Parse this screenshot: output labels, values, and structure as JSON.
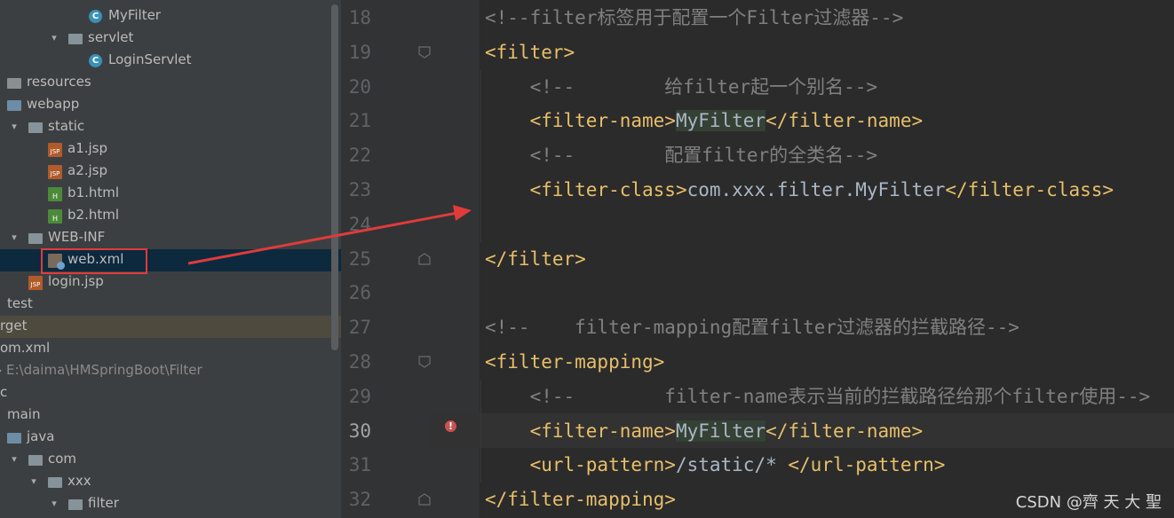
{
  "project_tree": {
    "items": [
      {
        "label": "MyFilter",
        "icon": "class-icon"
      },
      {
        "label": "servlet",
        "icon": "folder-icon",
        "arrow": "expanded"
      },
      {
        "label": "LoginServlet",
        "icon": "class-icon"
      },
      {
        "label": "resources",
        "icon": "resources-folder-icon"
      },
      {
        "label": "webapp",
        "icon": "web-folder-icon"
      },
      {
        "label": "static",
        "icon": "folder-icon",
        "arrow": "expanded"
      },
      {
        "label": "a1.jsp",
        "icon": "jsp-file-icon"
      },
      {
        "label": "a2.jsp",
        "icon": "jsp-file-icon"
      },
      {
        "label": "b1.html",
        "icon": "html-file-icon"
      },
      {
        "label": "b2.html",
        "icon": "html-file-icon"
      },
      {
        "label": "WEB-INF",
        "icon": "folder-icon",
        "arrow": "expanded"
      },
      {
        "label": "web.xml",
        "icon": "xml-file-icon",
        "selected": true
      },
      {
        "label": "login.jsp",
        "icon": "jsp-file-icon"
      },
      {
        "label": "test",
        "icon": "none"
      },
      {
        "label": "rget",
        "icon": "none",
        "highlight": true
      },
      {
        "label": "om.xml",
        "icon": "none"
      },
      {
        "label": "E:\\daima\\HMSpringBoot\\Filter",
        "icon": "none",
        "muted": true
      },
      {
        "label": "c",
        "icon": "none"
      },
      {
        "label": "main",
        "icon": "none"
      },
      {
        "label": "java",
        "icon": "source-folder-icon"
      },
      {
        "label": "com",
        "icon": "package-folder-icon",
        "arrow": "expanded"
      },
      {
        "label": "xxx",
        "icon": "package-folder-icon",
        "arrow": "expanded"
      },
      {
        "label": "filter",
        "icon": "package-folder-icon",
        "arrow": "expanded"
      }
    ]
  },
  "editor": {
    "current_line": 30,
    "lines": [
      {
        "num": "18",
        "segments": [
          {
            "t": "<!--filter标签用于配置一个Filter过滤器-->",
            "c": "cmt"
          }
        ]
      },
      {
        "num": "19",
        "segments": [
          {
            "t": "<filter>",
            "c": "tag"
          }
        ]
      },
      {
        "num": "20",
        "segments": [
          {
            "t": "    <!--        给filter起一个别名-->",
            "c": "cmt"
          }
        ]
      },
      {
        "num": "21",
        "segments": [
          {
            "t": "    ",
            "c": "txt"
          },
          {
            "t": "<filter-name>",
            "c": "tag"
          },
          {
            "t": "MyFilter",
            "c": "ident"
          },
          {
            "t": "</filter-name>",
            "c": "tag"
          }
        ]
      },
      {
        "num": "22",
        "segments": [
          {
            "t": "    <!--        配置filter的全类名-->",
            "c": "cmt"
          }
        ]
      },
      {
        "num": "23",
        "segments": [
          {
            "t": "    ",
            "c": "txt"
          },
          {
            "t": "<filter-class>",
            "c": "tag"
          },
          {
            "t": "com.xxx.filter.MyFilter",
            "c": "txt"
          },
          {
            "t": "</filter-class>",
            "c": "tag"
          }
        ]
      },
      {
        "num": "24",
        "segments": []
      },
      {
        "num": "25",
        "segments": [
          {
            "t": "</filter>",
            "c": "tag"
          }
        ]
      },
      {
        "num": "26",
        "segments": []
      },
      {
        "num": "27",
        "segments": [
          {
            "t": "<!--    filter-mapping配置filter过滤器的拦截路径-->",
            "c": "cmt"
          }
        ]
      },
      {
        "num": "28",
        "segments": [
          {
            "t": "<filter-mapping>",
            "c": "tag"
          }
        ]
      },
      {
        "num": "29",
        "segments": [
          {
            "t": "    <!--        filter-name表示当前的拦截路径给那个filter使用-->",
            "c": "cmt"
          }
        ]
      },
      {
        "num": "30",
        "segments": [
          {
            "t": "    ",
            "c": "txt"
          },
          {
            "t": "<filter-name>",
            "c": "tag"
          },
          {
            "t": "MyFilter",
            "c": "ident"
          },
          {
            "t": "</filter-name>",
            "c": "tag"
          }
        ]
      },
      {
        "num": "31",
        "segments": [
          {
            "t": "    ",
            "c": "txt"
          },
          {
            "t": "<url-pattern>",
            "c": "tag"
          },
          {
            "t": "/static/* ",
            "c": "txt"
          },
          {
            "t": "</url-pattern>",
            "c": "tag"
          }
        ]
      },
      {
        "num": "32",
        "segments": [
          {
            "t": "</filter-mapping>",
            "c": "tag"
          }
        ]
      }
    ]
  },
  "watermark": "CSDN @齊 天 大 聖",
  "colors": {
    "annotation_red": "#e03b3b",
    "tag": "#e8bf6a",
    "comment": "#808080"
  }
}
